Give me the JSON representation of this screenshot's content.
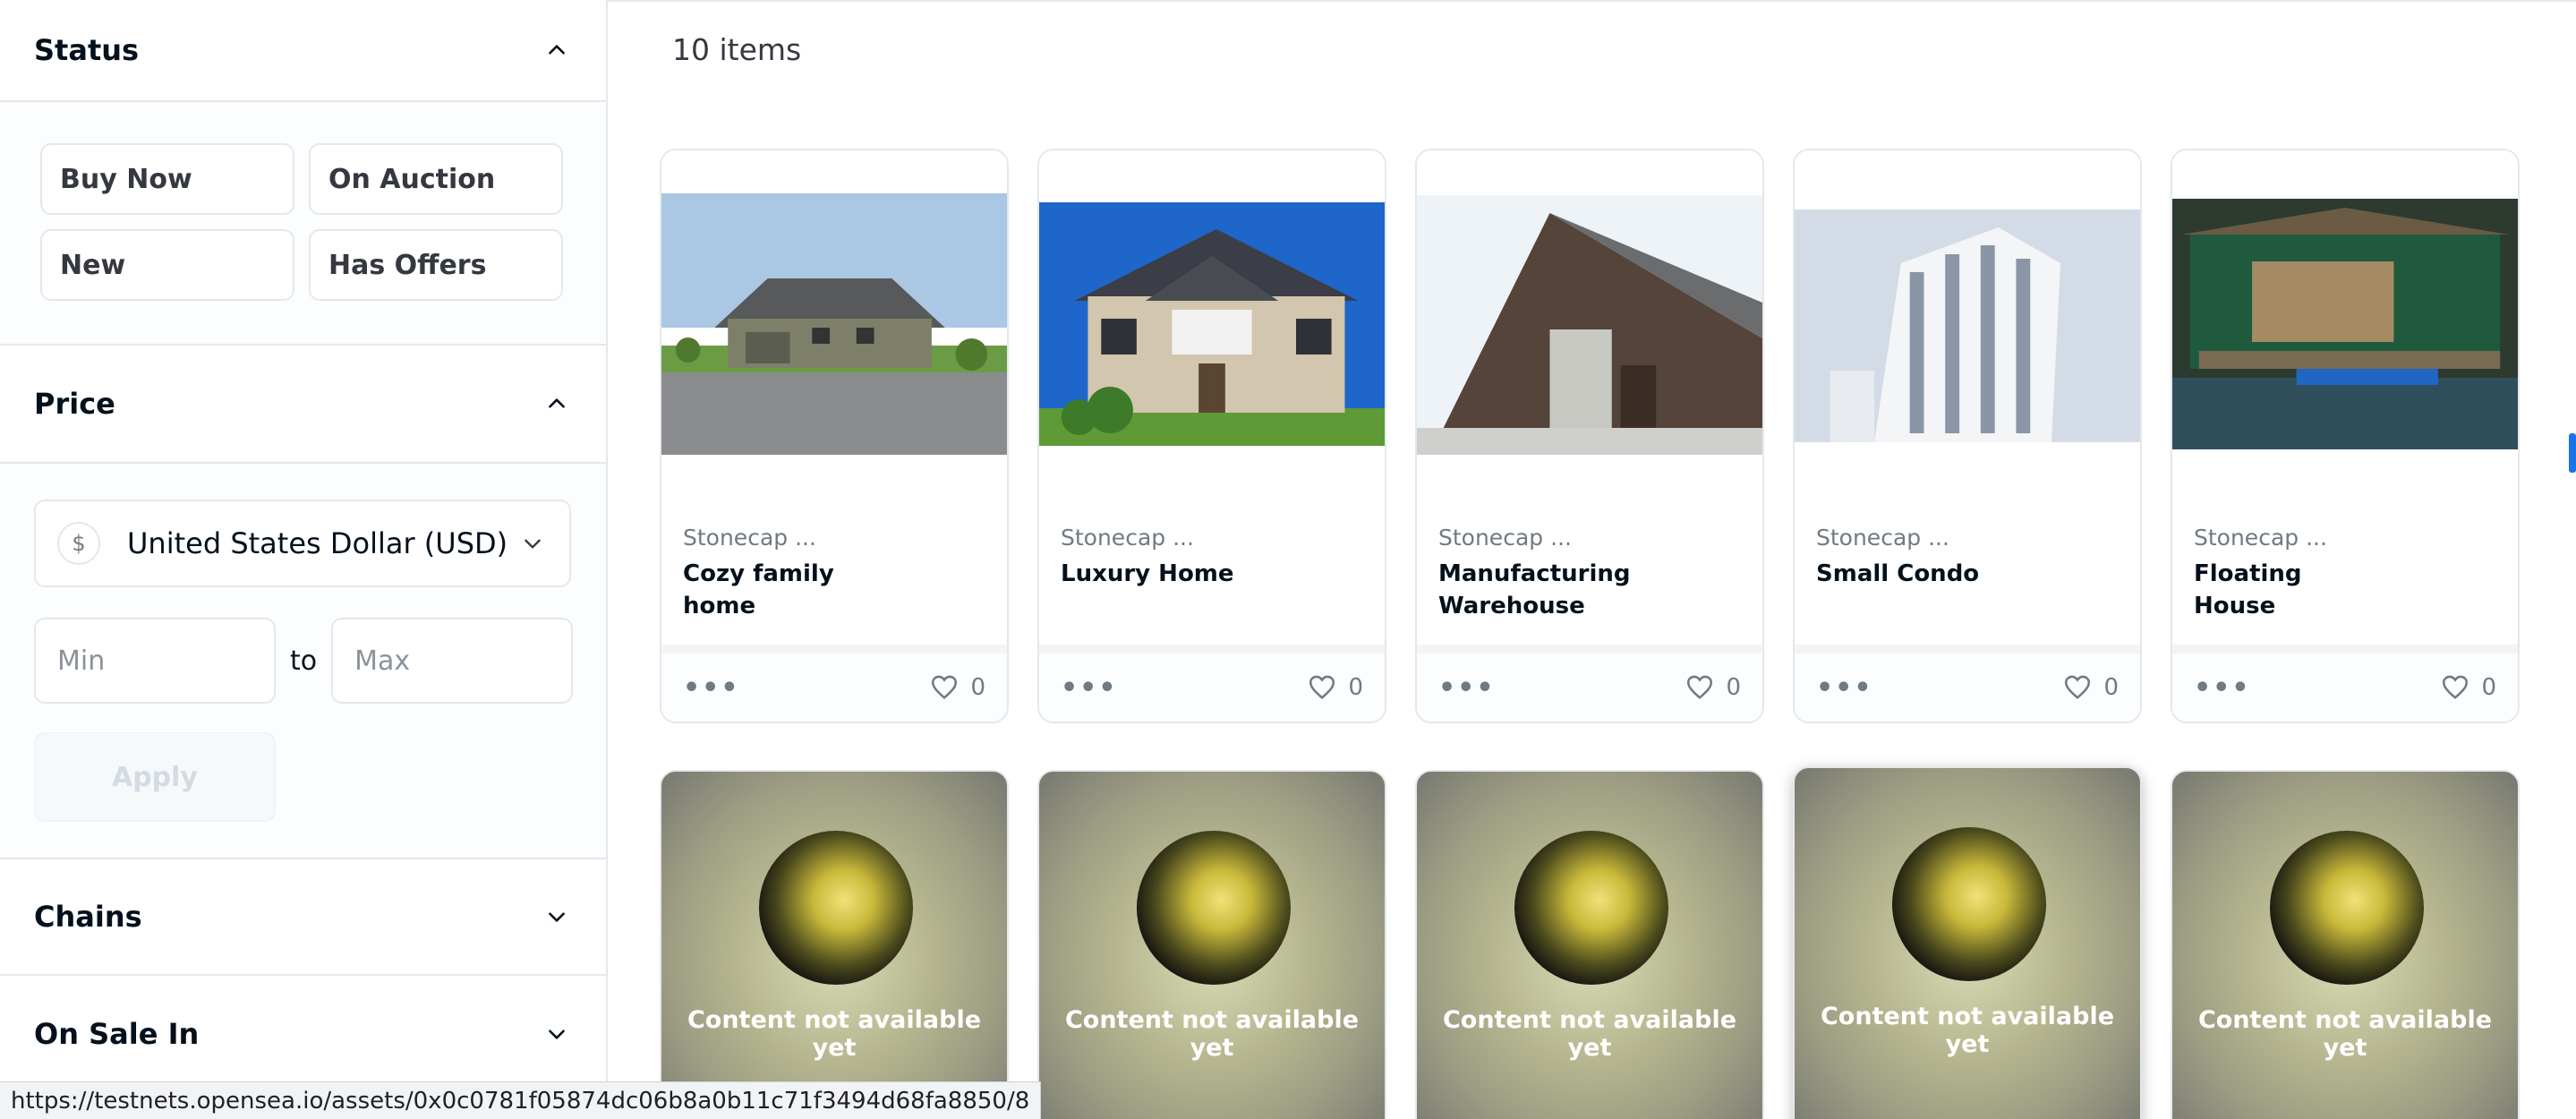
{
  "sidebar": {
    "status": {
      "title": "Status",
      "buttons": [
        "Buy Now",
        "On Auction",
        "New",
        "Has Offers"
      ]
    },
    "price": {
      "title": "Price",
      "currency": "United States Dollar (USD)",
      "currency_symbol": "$",
      "min_placeholder": "Min",
      "max_placeholder": "Max",
      "to_label": "to",
      "apply_label": "Apply"
    },
    "chains": {
      "title": "Chains"
    },
    "on_sale_in": {
      "title": "On Sale In"
    }
  },
  "main": {
    "items_count": "10 items",
    "cards": [
      {
        "collection": "Stonecap ...",
        "name": "Cozy family home",
        "likes": "0"
      },
      {
        "collection": "Stonecap ...",
        "name": "Luxury Home",
        "likes": "0"
      },
      {
        "collection": "Stonecap ...",
        "name": "Manufacturing Warehouse",
        "likes": "0"
      },
      {
        "collection": "Stonecap ...",
        "name": "Small Condo",
        "likes": "0"
      },
      {
        "collection": "Stonecap ...",
        "name": "Floating House",
        "likes": "0"
      }
    ],
    "placeholder_cards": [
      {
        "message": "Content not available yet"
      },
      {
        "message": "Content not available yet"
      },
      {
        "message": "Content not available yet"
      },
      {
        "message": "Content not available yet"
      },
      {
        "message": "Content not available yet"
      }
    ],
    "more_label": "•••"
  },
  "statusbar": {
    "url": "https://testnets.opensea.io/assets/0x0c0781f05874dc06b8a0b11c71f3494d68fa8850/8"
  }
}
